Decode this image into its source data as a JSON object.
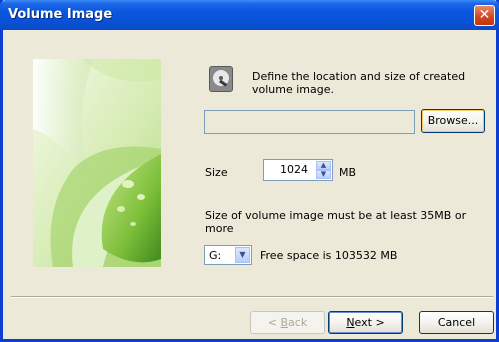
{
  "window": {
    "title": "Volume Image"
  },
  "description": "Define the location and size of created volume image.",
  "path_input": {
    "value": ""
  },
  "browse_label": "Browse...",
  "size": {
    "label": "Size",
    "value": "1024",
    "unit": "MB"
  },
  "note": "Size of volume image must be at least 35MB or more",
  "drive": {
    "value": "G:",
    "free_space": "Free space is 103532 MB"
  },
  "buttons": {
    "back_key": "B",
    "back_rest": "ack",
    "back_prefix": "< ",
    "next_key": "N",
    "next_rest": "ext >",
    "cancel": "Cancel"
  },
  "icons": {
    "close": "close-icon",
    "disk": "disk-icon",
    "spin_up": "up-arrow-icon",
    "spin_down": "down-arrow-icon",
    "dropdown": "chevron-down-icon"
  },
  "colors": {
    "titlebar": "#0a55e0",
    "dialog_bg": "#ece9d8",
    "button_border": "#003c74"
  }
}
